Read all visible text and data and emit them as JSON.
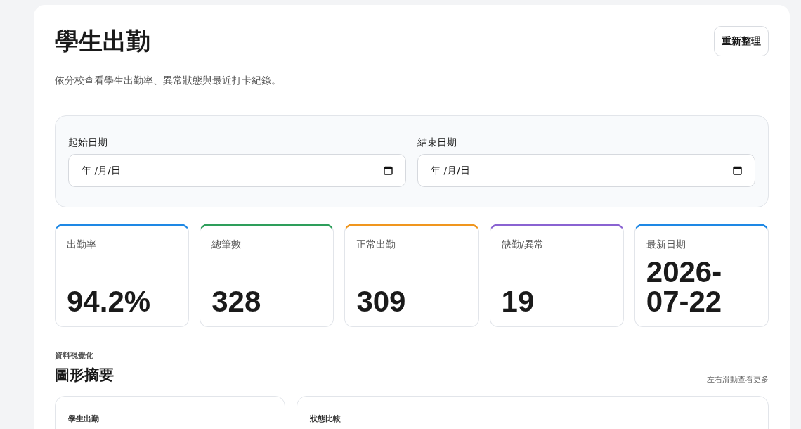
{
  "header": {
    "title": "學生出勤",
    "subtitle": "依分校查看學生出勤率、異常狀態與最近打卡紀錄。",
    "refresh_button": "重新整理"
  },
  "filters": [
    {
      "label": "起始日期",
      "placeholder": "年 /月/日"
    },
    {
      "label": "結束日期",
      "placeholder": "年 /月/日"
    }
  ],
  "stats": [
    {
      "label": "出勤率",
      "value": "94.2%",
      "color": "#1e88e5"
    },
    {
      "label": "總筆數",
      "value": "328",
      "color": "#2e9e5b"
    },
    {
      "label": "正常出勤",
      "value": "309",
      "color": "#f0961e"
    },
    {
      "label": "缺勤/異常",
      "value": "19",
      "color": "#8a63d2"
    },
    {
      "label": "最新日期",
      "value": "2026-07-22",
      "color": "#1e88e5"
    }
  ],
  "charts_section": {
    "eyebrow": "資料視覺化",
    "title": "圖形摘要",
    "hint": "左右滑動查看更多",
    "cards": [
      {
        "title": "學生出勤"
      },
      {
        "title": "狀態比較"
      }
    ]
  }
}
